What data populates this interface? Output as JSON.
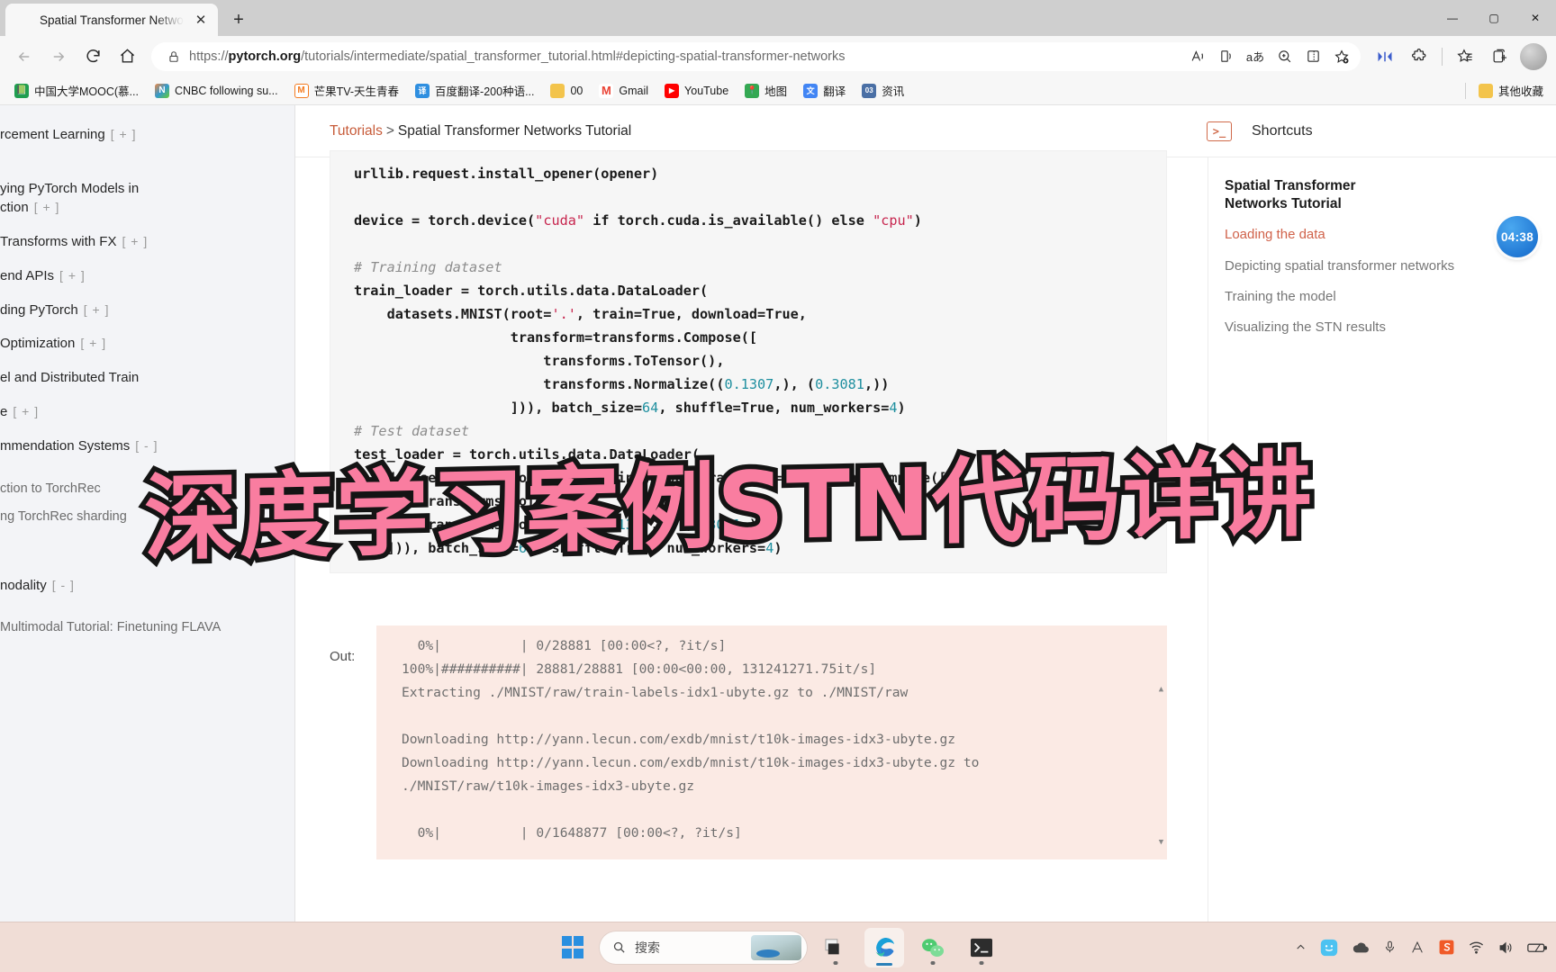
{
  "browser": {
    "tab": {
      "title": "Spatial Transformer Networks Tu",
      "close": "✕"
    },
    "newtab_label": "+",
    "window_controls": {
      "minimize": "—",
      "maximize": "▢",
      "close": "✕"
    },
    "nav": {
      "back": "←",
      "forward": "→",
      "refresh": "⟳",
      "home": "⌂"
    },
    "address": {
      "lock_icon": "lock-icon",
      "url_prefix": "https://",
      "url_domain": "pytorch.org",
      "url_path": "/tutorials/intermediate/spatial_transformer_tutorial.html#depicting-spatial-transformer-networks"
    },
    "omnibox_icons": [
      "read-aloud-icon",
      "immersive-reader-icon",
      "translate-icon",
      "zoom-icon",
      "split-screen-icon",
      "add-favorite-icon"
    ],
    "toolbar_icons": [
      "collections-split-icon",
      "extensions-icon",
      "favorites-icon",
      "collections-icon",
      "profile-avatar"
    ],
    "bookmarks": [
      {
        "label": "中国大学MOOC(慕...",
        "color": "#1f9e4f",
        "glyph": "M"
      },
      {
        "label": "CNBC following su...",
        "color": "#ffffff",
        "glyph": "N"
      },
      {
        "label": "芒果TV-天生青春",
        "color": "#f47b20",
        "glyph": "M"
      },
      {
        "label": "百度翻译-200种语...",
        "color": "#2f8fe0",
        "glyph": "译"
      },
      {
        "label": "00",
        "color": "#f3c44c",
        "glyph": "📁"
      },
      {
        "label": "Gmail",
        "color": "#ffffff",
        "glyph": "M"
      },
      {
        "label": "YouTube",
        "color": "#ff0000",
        "glyph": "▶"
      },
      {
        "label": "地图",
        "color": "#34a853",
        "glyph": "📍"
      },
      {
        "label": "翻译",
        "color": "#4285f4",
        "glyph": "文"
      },
      {
        "label": "资讯",
        "color": "#4a6fa5",
        "glyph": "03"
      }
    ],
    "other_favorites": {
      "label": "其他收藏",
      "glyph": "📁"
    }
  },
  "left_nav": {
    "items": [
      {
        "label": "rcement Learning",
        "toggle": "[ + ]",
        "sub": false
      },
      {
        "label": "ying PyTorch Models in\nction",
        "toggle": "[ + ]",
        "sub": false
      },
      {
        "label": "Transforms with FX",
        "toggle": "[ + ]",
        "sub": false
      },
      {
        "label": "end APIs",
        "toggle": "[ + ]",
        "sub": false
      },
      {
        "label": "ding PyTorch",
        "toggle": "[ + ]",
        "sub": false
      },
      {
        "label": " Optimization",
        "toggle": "[ + ]",
        "sub": false
      },
      {
        "label": "el and Distributed Train",
        "toggle": "",
        "sub": false
      },
      {
        "label": "e",
        "toggle": "[ + ]",
        "sub": false
      },
      {
        "label": "mmendation Systems",
        "toggle": "[ - ]",
        "sub": false
      },
      {
        "label": "ction to TorchRec",
        "toggle": "",
        "sub": true
      },
      {
        "label": "ng TorchRec sharding",
        "toggle": "",
        "sub": true
      },
      {
        "label": "nodality",
        "toggle": "[ - ]",
        "sub": false
      },
      {
        "label": "Multimodal Tutorial: Finetuning FLAVA",
        "toggle": "",
        "sub": true
      }
    ]
  },
  "breadcrumb": {
    "root": "Tutorials",
    "sep": ">",
    "current": "Spatial Transformer Networks Tutorial"
  },
  "code": {
    "line_partial": "urllib.request.install_opener(opener)",
    "lines": [
      "",
      "device = torch.device(\"cuda\" if torch.cuda.is_available() else \"cpu\")",
      "",
      "# Training dataset",
      "train_loader = torch.utils.data.DataLoader(",
      "    datasets.MNIST(root='.', train=True, download=True,",
      "                   transform=transforms.Compose([",
      "                       transforms.ToTensor(),",
      "                       transforms.Normalize((0.1307,), (0.3081,))",
      "                   ])), batch_size=64, shuffle=True, num_workers=4)",
      "# Test dataset",
      "test_loader = torch.utils.data.DataLoader(",
      "    datasets.MNIST(root='.', train=False, transform=transforms.Compose([",
      "        transforms.ToTensor(),",
      "        transforms.Normalize((0.1307,), (0.3081,))",
      "    ])), batch_size=64, shuffle=True, num_workers=4)"
    ]
  },
  "output": {
    "label": "Out:",
    "text": "  0%|          | 0/28881 [00:00<?, ?it/s]\n100%|##########| 28881/28881 [00:00<00:00, 131241271.75it/s]\nExtracting ./MNIST/raw/train-labels-idx1-ubyte.gz to ./MNIST/raw\n\nDownloading http://yann.lecun.com/exdb/mnist/t10k-images-idx3-ubyte.gz\nDownloading http://yann.lecun.com/exdb/mnist/t10k-images-idx3-ubyte.gz to\n./MNIST/raw/t10k-images-idx3-ubyte.gz\n\n  0%|          | 0/1648877 [00:00<?, ?it/s]",
    "scroll_up": "▲",
    "scroll_down": "▼"
  },
  "right_panel": {
    "shortcuts_label": "Shortcuts",
    "terminal_icon": ">_",
    "toc_title": "Spatial Transformer\nNetworks Tutorial",
    "toc_items": [
      {
        "label": "Loading the data",
        "active": true
      },
      {
        "label": "Depicting spatial transformer networks",
        "active": false
      },
      {
        "label": "Training the model",
        "active": false
      },
      {
        "label": "Visualizing the STN results",
        "active": false
      }
    ]
  },
  "timer": {
    "value": "04:38"
  },
  "watermark": {
    "text": "深度学习案例STN代码详讲",
    "fill": "#f97da0",
    "stroke": "#141414"
  },
  "taskbar": {
    "start_label": "windows-start-icon",
    "search_placeholder": "搜索",
    "search_icon": "search-icon",
    "apps": [
      {
        "name": "task-view",
        "glyph": "▤"
      },
      {
        "name": "microsoft-edge",
        "glyph": "e"
      },
      {
        "name": "wechat",
        "glyph": "W"
      },
      {
        "name": "terminal",
        "glyph": ">_"
      }
    ],
    "tray": [
      {
        "name": "show-hidden-icons",
        "glyph": "⌃"
      },
      {
        "name": "copilot-icon",
        "glyph": "☺"
      },
      {
        "name": "onedrive-icon",
        "glyph": "☁"
      },
      {
        "name": "microphone-icon",
        "glyph": "🎙"
      },
      {
        "name": "ime-icon",
        "glyph": "A"
      },
      {
        "name": "sogou-icon",
        "glyph": "S"
      },
      {
        "name": "wifi-icon",
        "glyph": "📶"
      },
      {
        "name": "volume-icon",
        "glyph": "🔊"
      },
      {
        "name": "battery-icon",
        "glyph": "▭"
      }
    ]
  }
}
